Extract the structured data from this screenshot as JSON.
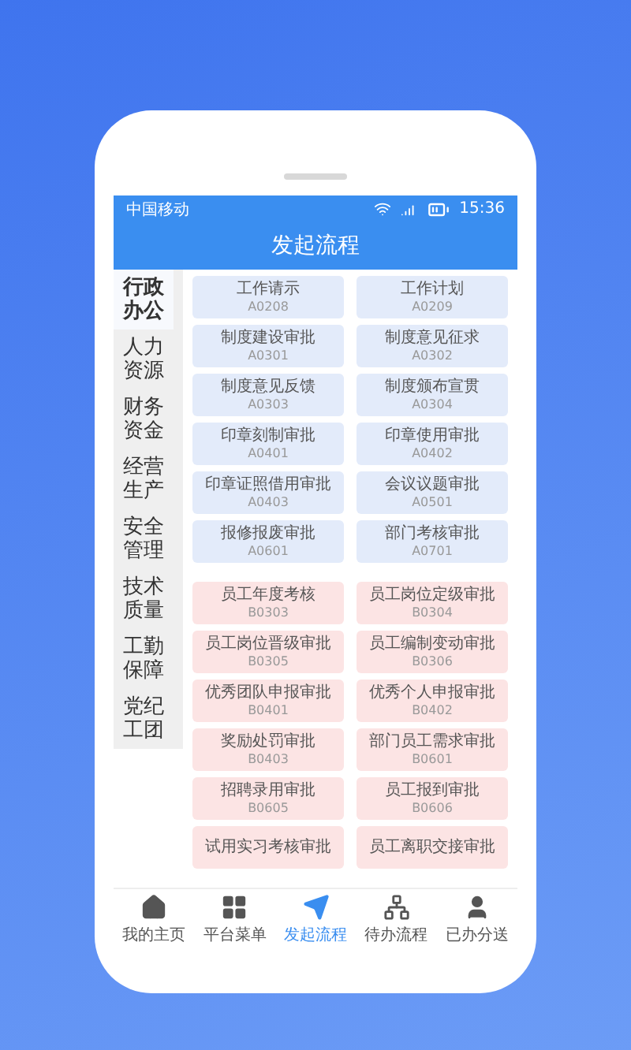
{
  "status_bar": {
    "carrier": "中国移动",
    "time": "15:36"
  },
  "title": "发起流程",
  "sidebar": [
    {
      "label": "行政办公",
      "selected": true
    },
    {
      "label": "人力资源",
      "selected": false
    },
    {
      "label": "财务资金",
      "selected": false
    },
    {
      "label": "经营生产",
      "selected": false
    },
    {
      "label": "安全管理",
      "selected": false
    },
    {
      "label": "技术质量",
      "selected": false
    },
    {
      "label": "工勤保障",
      "selected": false
    },
    {
      "label": "党纪工团",
      "selected": false
    }
  ],
  "groups": [
    {
      "color": "#e3ebfa",
      "items": [
        {
          "name": "工作请示",
          "code": "A0208"
        },
        {
          "name": "工作计划",
          "code": "A0209"
        },
        {
          "name": "制度建设审批",
          "code": "A0301"
        },
        {
          "name": "制度意见征求",
          "code": "A0302"
        },
        {
          "name": "制度意见反馈",
          "code": "A0303"
        },
        {
          "name": "制度颁布宣贯",
          "code": "A0304"
        },
        {
          "name": "印章刻制审批",
          "code": "A0401"
        },
        {
          "name": "印章使用审批",
          "code": "A0402"
        },
        {
          "name": "印章证照借用审批",
          "code": "A0403"
        },
        {
          "name": "会议议题审批",
          "code": "A0501"
        },
        {
          "name": "报修报废审批",
          "code": "A0601"
        },
        {
          "name": "部门考核审批",
          "code": "A0701"
        }
      ]
    },
    {
      "color": "#fce4e4",
      "items": [
        {
          "name": "员工年度考核",
          "code": "B0303"
        },
        {
          "name": "员工岗位定级审批",
          "code": "B0304"
        },
        {
          "name": "员工岗位晋级审批",
          "code": "B0305"
        },
        {
          "name": "员工编制变动审批",
          "code": "B0306"
        },
        {
          "name": "优秀团队申报审批",
          "code": "B0401"
        },
        {
          "name": "优秀个人申报审批",
          "code": "B0402"
        },
        {
          "name": "奖励处罚审批",
          "code": "B0403"
        },
        {
          "name": "部门员工需求审批",
          "code": "B0601"
        },
        {
          "name": "招聘录用审批",
          "code": "B0605"
        },
        {
          "name": "员工报到审批",
          "code": "B0606"
        },
        {
          "name": "试用实习考核审批"
        },
        {
          "name": "员工离职交接审批"
        }
      ]
    }
  ],
  "tabs": [
    {
      "kind": "home",
      "label": "我的主页",
      "selected": false
    },
    {
      "kind": "grid",
      "label": "平台菜单",
      "selected": false
    },
    {
      "kind": "send",
      "label": "发起流程",
      "selected": true
    },
    {
      "kind": "tree",
      "label": "待办流程",
      "selected": false
    },
    {
      "kind": "user",
      "label": "已办分送",
      "selected": false
    }
  ]
}
